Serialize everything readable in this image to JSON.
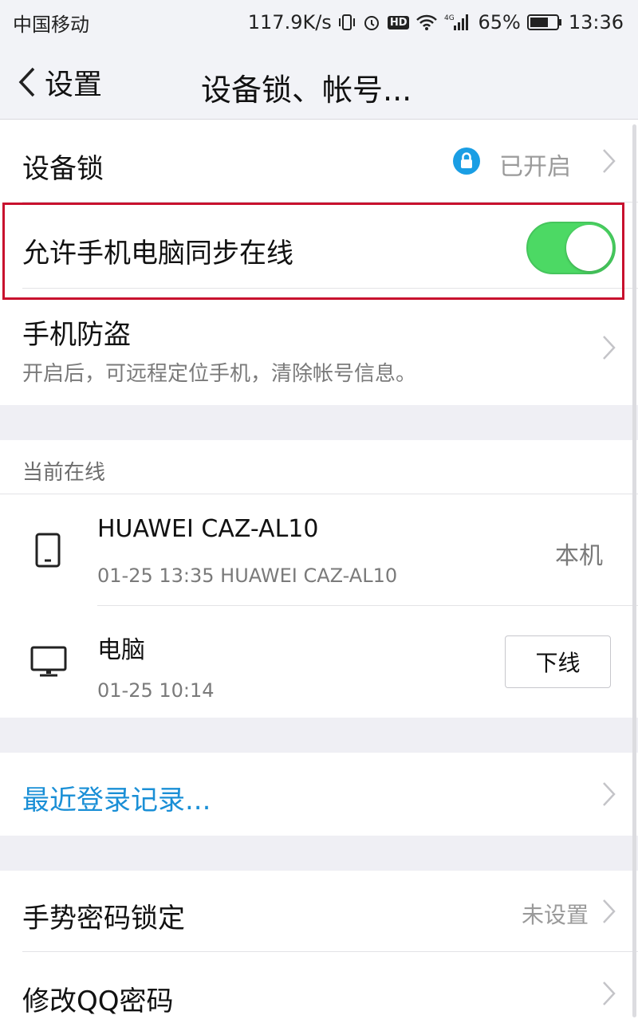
{
  "status_bar": {
    "carrier": "中国移动",
    "speed": "117.9K/s",
    "network": "4G",
    "battery": "65%",
    "time": "13:36"
  },
  "nav": {
    "back_label": "设置",
    "title": "设备锁、帐号..."
  },
  "device_lock": {
    "label": "设备锁",
    "status": "已开启",
    "icon": "lock-icon"
  },
  "sync_online": {
    "label": "允许手机电脑同步在线",
    "enabled": true
  },
  "anti_theft": {
    "label": "手机防盗",
    "description": "开启后，可远程定位手机，清除帐号信息。"
  },
  "online": {
    "header": "当前在线",
    "devices": [
      {
        "name": "HUAWEI CAZ-AL10",
        "time": "01-25 13:35 HUAWEI CAZ-AL10",
        "tag": "本机",
        "icon": "phone-icon"
      },
      {
        "name": "电脑",
        "time": "01-25 10:14",
        "action": "下线",
        "icon": "monitor-icon"
      }
    ]
  },
  "recent_login": {
    "label": "最近登录记录..."
  },
  "gesture_lock": {
    "label": "手势密码锁定",
    "status": "未设置"
  },
  "change_password": {
    "label": "修改QQ密码"
  },
  "colors": {
    "accent_blue": "#1a8fd6",
    "toggle_green": "#4cd964",
    "highlight_red": "#c8112e"
  }
}
